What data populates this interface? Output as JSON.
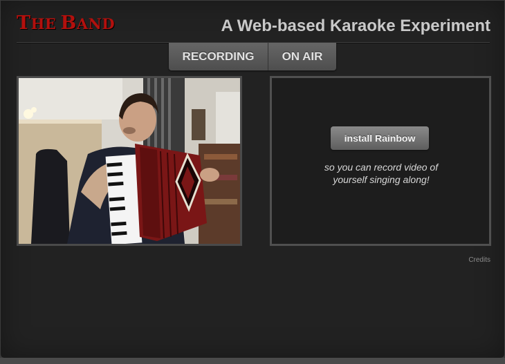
{
  "header": {
    "brand_the": "The",
    "brand_band": "Band",
    "tagline": "A Web-based Karaoke Experiment"
  },
  "tabs": [
    {
      "label": "RECORDING"
    },
    {
      "label": "ON AIR"
    }
  ],
  "video": {
    "description_icon": "accordion-video-frame"
  },
  "record_panel": {
    "install_button": "install Rainbow",
    "note_line1": "so you can record video of",
    "note_line2": "yourself singing along!"
  },
  "footer": {
    "credits": "Credits"
  },
  "colors": {
    "brand": "#b3100d",
    "background": "#222222",
    "tagline": "#c9c9c9"
  }
}
